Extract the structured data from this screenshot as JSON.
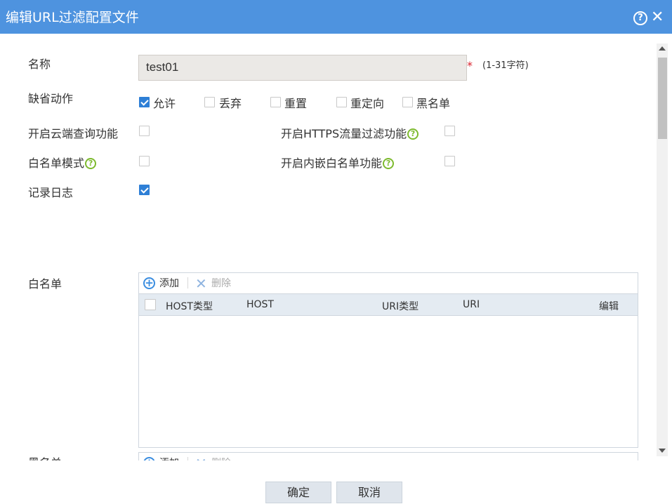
{
  "dialog": {
    "title": "编辑URL过滤配置文件",
    "help_icon": "question-circle-icon",
    "close_icon": "close-icon"
  },
  "form": {
    "name_label": "名称",
    "name_value": "test01",
    "required_mark": "*",
    "name_hint": "(1-31字符)",
    "default_action_label": "缺省动作",
    "actions": [
      {
        "label": "允许",
        "checked": true
      },
      {
        "label": "丢弃",
        "checked": false
      },
      {
        "label": "重置",
        "checked": false
      },
      {
        "label": "重定向",
        "checked": false
      },
      {
        "label": "黑名单",
        "checked": false
      }
    ],
    "cloud_query_label": "开启云端查询功能",
    "cloud_query_checked": false,
    "https_filter_label": "开启HTTPS流量过滤功能",
    "https_filter_checked": false,
    "whitelist_mode_label": "白名单模式",
    "whitelist_mode_checked": false,
    "embedded_whitelist_label": "开启内嵌白名单功能",
    "embedded_whitelist_checked": false,
    "log_label": "记录日志",
    "log_checked": true,
    "help_icon": "question-mark-icon"
  },
  "whitelist": {
    "label": "白名单",
    "add_label": "添加",
    "delete_label": "删除",
    "columns": [
      "HOST类型",
      "HOST",
      "URI类型",
      "URI",
      "编辑"
    ],
    "rows": []
  },
  "blacklist": {
    "label": "黑名单",
    "add_label": "添加",
    "delete_label": "删除"
  },
  "footer": {
    "ok_label": "确定",
    "cancel_label": "取消"
  },
  "colors": {
    "titlebar": "#4e93df",
    "checkbox_on": "#2e7fd6",
    "help_icon": "#7dba2e",
    "table_header": "#e4ebf2",
    "required": "#d9232e"
  }
}
